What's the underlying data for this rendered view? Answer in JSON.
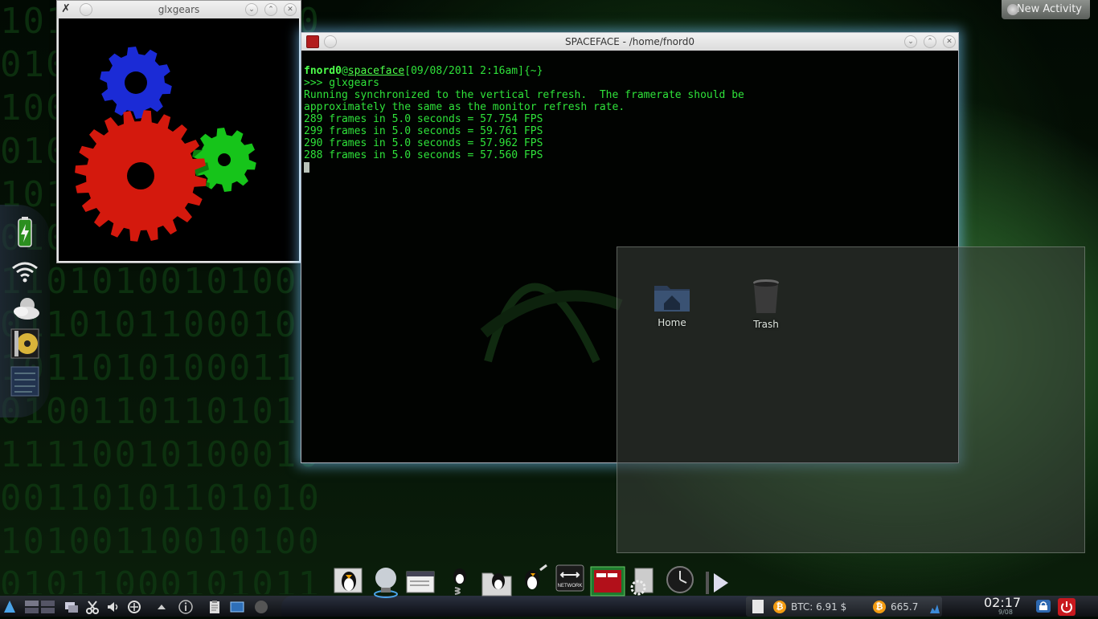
{
  "desktop": {
    "binary_rows": [
      "10101 01011100",
      "01010 01100101",
      "10010010111010",
      "01001011001000",
      "10100010110010",
      "01011000101011",
      "11010100101000",
      "01101011000101",
      "10110101000110",
      "01001101101011",
      "11110010100010",
      "00110101101010",
      "10100110010100",
      "01011000101011"
    ],
    "icons": [
      {
        "name": "Home"
      },
      {
        "name": "Trash"
      }
    ]
  },
  "new_activity": {
    "label": "New Activity"
  },
  "glxgears_window": {
    "title": "glxgears"
  },
  "terminal_window": {
    "title": "SPACEFACE - /home/fnord0",
    "prompt_user": "fnord0",
    "prompt_at": "@",
    "prompt_host": "spaceface",
    "prompt_rest": "[09/08/2011 2:16am]{~}",
    "command_line": ">>> glxgears",
    "output": [
      "Running synchronized to the vertical refresh.  The framerate should be",
      "approximately the same as the monitor refresh rate.",
      "289 frames in 5.0 seconds = 57.754 FPS",
      "299 frames in 5.0 seconds = 59.761 FPS",
      "290 frames in 5.0 seconds = 57.962 FPS",
      "288 frames in 5.0 seconds = 57.560 FPS"
    ]
  },
  "dock": {
    "items": [
      {
        "icon": "tux-console-icon"
      },
      {
        "icon": "crystal-ball-icon"
      },
      {
        "icon": "files-icon"
      },
      {
        "icon": "tux-spring-icon"
      },
      {
        "icon": "tux-folder-icon"
      },
      {
        "icon": "tux-edit-icon"
      },
      {
        "icon": "network-icon",
        "label": "NETWORK"
      },
      {
        "icon": "terminal-icon"
      },
      {
        "icon": "settings-icon"
      },
      {
        "icon": "clock-icon"
      },
      {
        "icon": "arrow-icon"
      }
    ]
  },
  "panel": {
    "btc_label": "BTC: 6.91 $",
    "btc_value2": "665.7",
    "clock_time": "02:17",
    "clock_sub": "9/08"
  },
  "colors": {
    "terminal_text": "#2fe23a",
    "gear_red": "#d4190d",
    "gear_green": "#16c41a",
    "gear_blue": "#1b2bd6"
  }
}
